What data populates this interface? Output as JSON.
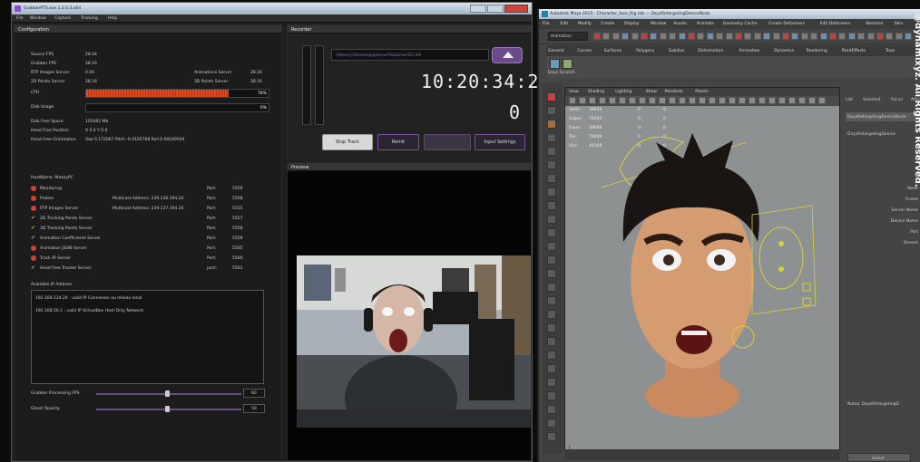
{
  "grabber": {
    "title": "GrabberPTS.exe 1.2.0.3.x64",
    "menu": [
      "File",
      "Window",
      "Capture",
      "Tracking",
      "Help"
    ],
    "config_title": "Configuration",
    "recorder_title": "Recorder",
    "preview_title": "Preview",
    "stats": [
      {
        "label": "Source FPS",
        "value": "28.04"
      },
      {
        "label": "Grabber FPS",
        "value": "28.16"
      },
      {
        "label": "RTP Images Server",
        "value": "0.00"
      },
      {
        "label": "2D Points Server",
        "value": "28.16"
      }
    ],
    "stats_right": [
      {
        "label": "Animations Server",
        "value": "28.16"
      },
      {
        "label": "3D Points Server",
        "value": "28.16"
      }
    ],
    "cpu_label": "CPU",
    "cpu_pct": "78%",
    "cpu_fraction": 0.78,
    "disk_label": "Disk Usage",
    "disk_pct": "0%",
    "disk_free_label": "Disk Free Space",
    "disk_free_value": "102492 Mb",
    "head_pos_label": "Head Free Position",
    "head_pos_value": "X 0.0 Y 0.0",
    "head_orient_label": "Head Free Orientation",
    "head_orient_value": "Yaw 0.172067 Pitch -0.0105768 Roll 0.00249594",
    "host_label": "HostName: MaseyPC",
    "services": [
      {
        "status": "off",
        "name": "Monitoring",
        "key": "Port:",
        "val": "5556"
      },
      {
        "status": "off",
        "name": "Probes",
        "mid": "Multicast Address: 239.136.194.24",
        "key": "Port:",
        "val": "5568"
      },
      {
        "status": "off",
        "name": "RTP Images Server",
        "mid": "Multicast Address: 239.137.194.24",
        "key": "Port:",
        "val": "5555"
      },
      {
        "status": "on",
        "name": "2D Tracking Points Server",
        "key": "Port:",
        "val": "5557"
      },
      {
        "status": "on",
        "name": "3D Tracking Points Server",
        "key": "Port:",
        "val": "5558"
      },
      {
        "status": "on",
        "name": "Animation Coefficients Server",
        "key": "Port:",
        "val": "5559"
      },
      {
        "status": "off",
        "name": "Animation JSON Server",
        "key": "Port:",
        "val": "5565"
      },
      {
        "status": "off",
        "name": "Track IR Server",
        "key": "Port:",
        "val": "5560"
      },
      {
        "status": "on",
        "name": "Head Free Tracker Server",
        "key": "port:",
        "val": "5561"
      }
    ],
    "ip_label": "Available IP Address",
    "ip_lines": [
      "192.168.124.24 : valid IP Connexion au réseau local",
      "192.168.56.1 : valid IP VirtualBox Host-Only Network"
    ],
    "slider1_label": "Grabber Processing FPS",
    "slider1_value": "60",
    "slider1_fraction": 0.49,
    "slider2_label": "Ghost Opacity",
    "slider2_value": "50",
    "slider2_fraction": 0.49,
    "path": "\\\\Maseyr\\Desktop\\pjseverf\\Salomon62.AVI",
    "timecode": "10:20:34:23",
    "frame_count": "0",
    "buttons": [
      "Stop Track",
      "Reinit",
      "Input Settings"
    ]
  },
  "maya": {
    "title": "Autodesk Maya 2015 - Character_face_Rig.mb --- DxyzRetargetingDeviceNode",
    "menu": [
      "File",
      "Edit",
      "Modify",
      "Create",
      "Display",
      "Window",
      "Assets",
      "Animate",
      "Geometry Cache",
      "Create Deformers",
      "Edit Deformers",
      "Skeleton",
      "Skin"
    ],
    "mode": "Animation",
    "shelf_tabs": [
      "General",
      "Curves",
      "Surfaces",
      "Polygons",
      "Subdivs",
      "Deformation",
      "Animation",
      "Dynamics",
      "Rendering",
      "PaintEffects",
      "Toon"
    ],
    "shelf_sub": "Dxyz Scratch",
    "viewport_menu": [
      "View",
      "Shading",
      "Lighting",
      "Show",
      "Renderer",
      "Panels"
    ],
    "hud": [
      {
        "label": "Verts:",
        "v1": "39629",
        "v2": "0",
        "v3": "0"
      },
      {
        "label": "Edges:",
        "v1": "79265",
        "v2": "0",
        "v3": "0"
      },
      {
        "label": "Faces:",
        "v1": "39660",
        "v2": "0",
        "v3": "0"
      },
      {
        "label": "Tris:",
        "v1": "79049",
        "v2": "0",
        "v3": "0"
      },
      {
        "label": "UVs:",
        "v1": "40168",
        "v2": "0",
        "v3": "0"
      }
    ],
    "camera": "persp",
    "attr_tabs": [
      "List",
      "Selected",
      "Focus",
      "Attributes"
    ],
    "attr_node": "DxyzRetargetingDeviceNode",
    "attr_node2": "DxyzRetargetingDevice",
    "attr_fields": [
      "Node",
      "Frame",
      "Server Name",
      "Device Name",
      "Port",
      "Stream"
    ],
    "notes": "Notes: DxyzRetargetingD",
    "select_btn": "Select",
    "watermark": "@dynamixyz. All Rights Reserved."
  },
  "colors": {
    "accent": "#7a4fa0",
    "cpu_bar": "#e0491f",
    "ok": "#6fcf3a",
    "err": "#d0413a"
  }
}
